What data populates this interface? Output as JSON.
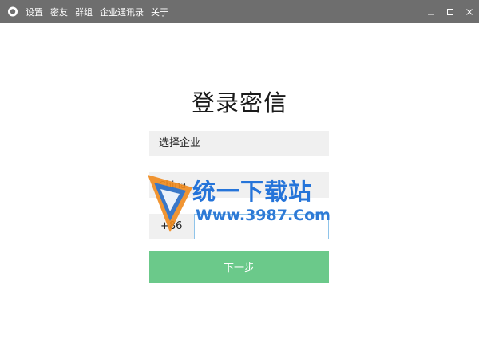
{
  "menu": {
    "items": [
      {
        "label": "设置"
      },
      {
        "label": "密友"
      },
      {
        "label": "群组"
      },
      {
        "label": "企业通讯录"
      },
      {
        "label": "关于"
      }
    ]
  },
  "login": {
    "title": "登录密信",
    "company_select": "选择企业",
    "country_select": "China",
    "dial_code": "+86",
    "phone_value": "",
    "next_button": "下一步"
  },
  "watermark": {
    "line1": "统一下载站",
    "line2": "Www.3987.Com"
  },
  "colors": {
    "titlebar": "#6e6e6e",
    "button": "#6bc98a",
    "field_bg": "#f0f0f0",
    "watermark_blue": "#2574d9",
    "watermark_orange": "#f08a1c"
  }
}
